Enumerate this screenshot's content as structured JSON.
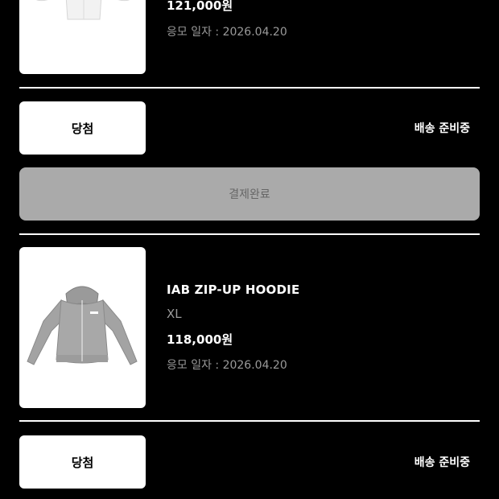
{
  "orders": [
    {
      "price": "121,000원",
      "apply_date": "응모 일자 : 2026.04.20",
      "thumb_icon": "white-zip-hoodie-image"
    },
    {
      "name": "IAB ZIP-UP HOODIE",
      "option": "XL",
      "price": "118,000원",
      "apply_date": "응모 일자 : 2026.04.20",
      "thumb_icon": "gray-zip-hoodie-image"
    }
  ],
  "status_rows": [
    {
      "result": "당첨",
      "shipping": "배송 준비중"
    },
    {
      "result": "당첨",
      "shipping": "배송 준비중"
    }
  ],
  "payment_button": {
    "label": "결제완료"
  },
  "colors": {
    "background": "#000000",
    "card": "#ffffff",
    "disabled_button": "#aaaaaa",
    "muted_text": "#9a9a9a"
  }
}
